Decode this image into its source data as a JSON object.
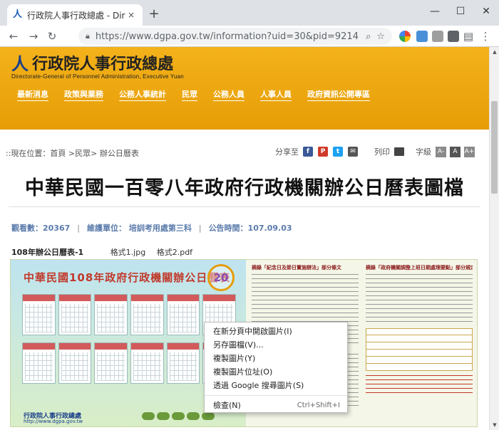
{
  "browser": {
    "tab_title": "行政院人事行政總處 - Directorate",
    "tab_close": "×",
    "new_tab": "+",
    "window_controls": {
      "minimize": "—",
      "maximize": "☐",
      "close": "✕"
    },
    "nav": {
      "back": "←",
      "forward": "→",
      "reload": "↻"
    },
    "url": "https://www.dgpa.gov.tw/information?uid=30&pid=9214"
  },
  "site": {
    "logo_zh": "行政院人事行政總處",
    "logo_en": "Directorate-General of Personnel Administration, Executive Yuan",
    "nav_items": [
      "最新消息",
      "政策與業務",
      "公務人事統計",
      "民眾",
      "公務人員",
      "人事人員",
      "政府資訊公開專區"
    ]
  },
  "breadcrumb": "::現在位置：首頁 >民眾> 辦公日曆表",
  "share": {
    "label": "分享至",
    "facebook": "f",
    "plurk": "P",
    "twitter": "t",
    "email": "✉",
    "print_label": "列印",
    "font_size_label": "字級",
    "font_small": "A-",
    "font_mid": "A",
    "font_large": "A+"
  },
  "page_title": "中華民國一百零八年政府行政機關辦公日曆表圖檔",
  "meta": {
    "views": "觀看數：20367",
    "unit": "維護單位： 培訓考用處第三科",
    "published": "公告時間：107.09.03"
  },
  "file": {
    "title": "108年辦公日曆表-1",
    "format1": "格式1.jpg",
    "format2": "格式2.pdf"
  },
  "calendar_image": {
    "heading": "中華民國108年政府行政機關辦公日曆表",
    "badge": "20",
    "footer_org": "行政院人事行政總處",
    "footer_url": "http://www.dgpa.gov.tw",
    "right_heading_1": "摘錄「紀念日及節日實施辦法」部分條文",
    "right_heading_2": "摘錄「政府機關調整上班日期處理要點」部分規定"
  },
  "context_menu": {
    "items": [
      {
        "label": "在新分頁中開啟圖片(I)"
      },
      {
        "label": "另存圖檔(V)..."
      },
      {
        "label": "複製圖片(Y)"
      },
      {
        "label": "複製圖片位址(O)"
      },
      {
        "label": "透過 Google 搜尋圖片(S)"
      }
    ],
    "inspect": {
      "label": "檢查(N)",
      "shortcut": "Ctrl+Shift+I"
    }
  },
  "colors": {
    "header": "#f4b21b",
    "facebook": "#3b5998",
    "plurk": "#cf3a2a",
    "twitter": "#1da1f2",
    "email": "#555555"
  }
}
